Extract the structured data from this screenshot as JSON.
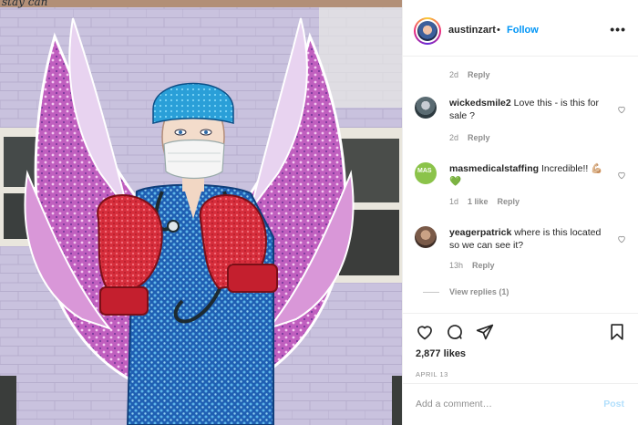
{
  "photo": {
    "top_strip_text": "stay can",
    "alt": "Mural of a nurse in scrubs, mask and boxing gloves with wings"
  },
  "post": {
    "username": "austinzart",
    "separator": "•",
    "follow_label": "Follow",
    "more_label": "•••"
  },
  "comments": [
    {
      "username": "",
      "text": "",
      "age": "2d",
      "reply_label": "Reply",
      "likes": ""
    },
    {
      "username": "wickedsmile2",
      "text": "Love this - is this for sale ?",
      "age": "2d",
      "reply_label": "Reply",
      "likes": ""
    },
    {
      "username": "masmedicalstaffing",
      "text": "Incredible!! 💪🏼💚",
      "age": "1d",
      "likes": "1 like",
      "reply_label": "Reply"
    },
    {
      "username": "yeagerpatrick",
      "text": "where is this located so we can see it?",
      "age": "13h",
      "reply_label": "Reply",
      "likes": ""
    }
  ],
  "view_replies": "View replies (1)",
  "likes_count": "2,877 likes",
  "date": "APRIL 13",
  "add_comment": {
    "placeholder": "Add a comment…",
    "post_label": "Post"
  },
  "colors": {
    "accent": "#0095f6",
    "post_disabled": "#b2dffc",
    "muted": "#8e8e8e"
  },
  "icons": {
    "like": "heart-icon",
    "comment": "comment-icon",
    "share": "paper-plane-icon",
    "save": "bookmark-icon"
  }
}
